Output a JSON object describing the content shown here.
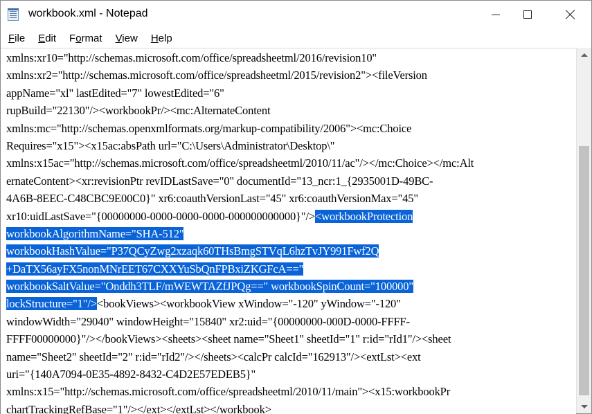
{
  "window": {
    "title": "workbook.xml - Notepad"
  },
  "menu": [
    {
      "acc": "F",
      "rest": "ile"
    },
    {
      "acc": "E",
      "rest": "dit"
    },
    {
      "acc": "",
      "pre": "F",
      "acc2": "o",
      "rest": "rmat"
    },
    {
      "acc": "V",
      "rest": "iew"
    },
    {
      "acc": "H",
      "rest": "elp"
    }
  ],
  "editor": {
    "lines": [
      {
        "pre": "xmlns:xr10=\"http://schemas.microsoft.com/office/spreadsheetml/2016/revision10\"",
        "sel": "",
        "post": ""
      },
      {
        "pre": "xmlns:xr2=\"http://schemas.microsoft.com/office/spreadsheetml/2015/revision2\"><fileVersion",
        "sel": "",
        "post": ""
      },
      {
        "pre": "appName=\"xl\" lastEdited=\"7\" lowestEdited=\"6\"",
        "sel": "",
        "post": ""
      },
      {
        "pre": "rupBuild=\"22130\"/><workbookPr/><mc:AlternateContent",
        "sel": "",
        "post": ""
      },
      {
        "pre": "xmlns:mc=\"http://schemas.openxmlformats.org/markup-compatibility/2006\"><mc:Choice",
        "sel": "",
        "post": ""
      },
      {
        "pre": "Requires=\"x15\"><x15ac:absPath url=\"C:\\Users\\Administrator\\Desktop\\\"",
        "sel": "",
        "post": ""
      },
      {
        "pre": "xmlns:x15ac=\"http://schemas.microsoft.com/office/spreadsheetml/2010/11/ac\"/></mc:Choice></mc:Alt",
        "sel": "",
        "post": ""
      },
      {
        "pre": "ernateContent><xr:revisionPtr revIDLastSave=\"0\" documentId=\"13_ncr:1_{2935001D-49BC-",
        "sel": "",
        "post": ""
      },
      {
        "pre": "4A6B-8EEC-C48CBC9E00C0}\" xr6:coauthVersionLast=\"45\" xr6:coauthVersionMax=\"45\"",
        "sel": "",
        "post": ""
      },
      {
        "pre": "xr10:uidLastSave=\"{00000000-0000-0000-0000-000000000000}\"/>",
        "sel": "<workbookProtection",
        "post": ""
      },
      {
        "pre": "",
        "sel": "workbookAlgorithmName=\"SHA-512\"",
        "post": ""
      },
      {
        "pre": "",
        "sel": "workbookHashValue=\"P37QCyZwg2xzaqk60THsBmgSTVqL6hzTvJY991Fwf2Q",
        "post": ""
      },
      {
        "pre": "",
        "sel": "+DaTX56ayFX5nonMNrEET67CXXYuSbQnFPBxiZKGFcA==\"",
        "post": ""
      },
      {
        "pre": "",
        "sel": "workbookSaltValue=\"Onddh3TLF/mWEWTAZfJPQg==\" workbookSpinCount=\"100000\"",
        "post": ""
      },
      {
        "pre": "",
        "sel": "lockStructure=\"1\"/>",
        "post": "<bookViews><workbookView xWindow=\"-120\" yWindow=\"-120\""
      },
      {
        "pre": "windowWidth=\"29040\" windowHeight=\"15840\" xr2:uid=\"{00000000-000D-0000-FFFF-",
        "sel": "",
        "post": ""
      },
      {
        "pre": "FFFF00000000}\"/></bookViews><sheets><sheet name=\"Sheet1\" sheetId=\"1\" r:id=\"rId1\"/><sheet",
        "sel": "",
        "post": ""
      },
      {
        "pre": "name=\"Sheet2\" sheetId=\"2\" r:id=\"rId2\"/></sheets><calcPr calcId=\"162913\"/><extLst><ext",
        "sel": "",
        "post": ""
      },
      {
        "pre": "uri=\"{140A7094-0E35-4892-8432-C4D2E57EDEB5}\"",
        "sel": "",
        "post": ""
      },
      {
        "pre": "xmlns:x15=\"http://schemas.microsoft.com/office/spreadsheetml/2010/11/main\"><x15:workbookPr",
        "sel": "",
        "post": ""
      },
      {
        "pre": "chartTrackingRefBase=\"1\"/></ext></extLst></workbook>",
        "sel": "",
        "post": ""
      }
    ]
  },
  "colors": {
    "selection": "#0a64d8",
    "scrollbar_thumb": "#c2c2c2"
  },
  "icons": {
    "app": "notepad-icon",
    "minimize": "minimize-icon",
    "maximize": "maximize-icon",
    "close": "close-icon"
  }
}
